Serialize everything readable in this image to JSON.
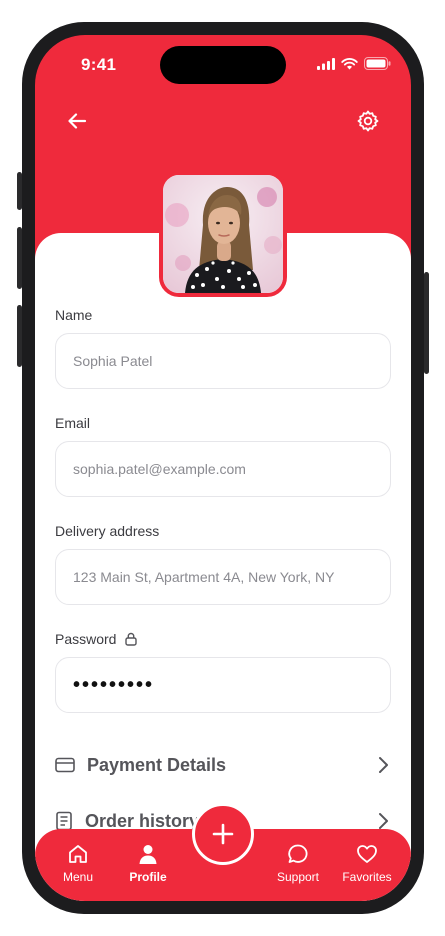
{
  "status": {
    "time": "9:41"
  },
  "header": {
    "back_icon": "arrow-left-icon",
    "settings_icon": "gear-icon"
  },
  "profile": {
    "photo": "profile-photo"
  },
  "form": {
    "name_label": "Name",
    "name_value": "Sophia Patel",
    "email_label": "Email",
    "email_value": "sophia.patel@example.com",
    "address_label": "Delivery address",
    "address_value": "123 Main St, Apartment 4A, New York, NY",
    "password_label": "Password",
    "password_value": "•••••••••"
  },
  "menu": {
    "payment_label": "Payment Details",
    "orders_label": "Order history"
  },
  "nav": {
    "menu_label": "Menu",
    "profile_label": "Profile",
    "support_label": "Support",
    "favorites_label": "Favorites"
  },
  "colors": {
    "accent": "#ef2a3c",
    "background": "#ffffff",
    "frame": "#1c1c1e"
  }
}
